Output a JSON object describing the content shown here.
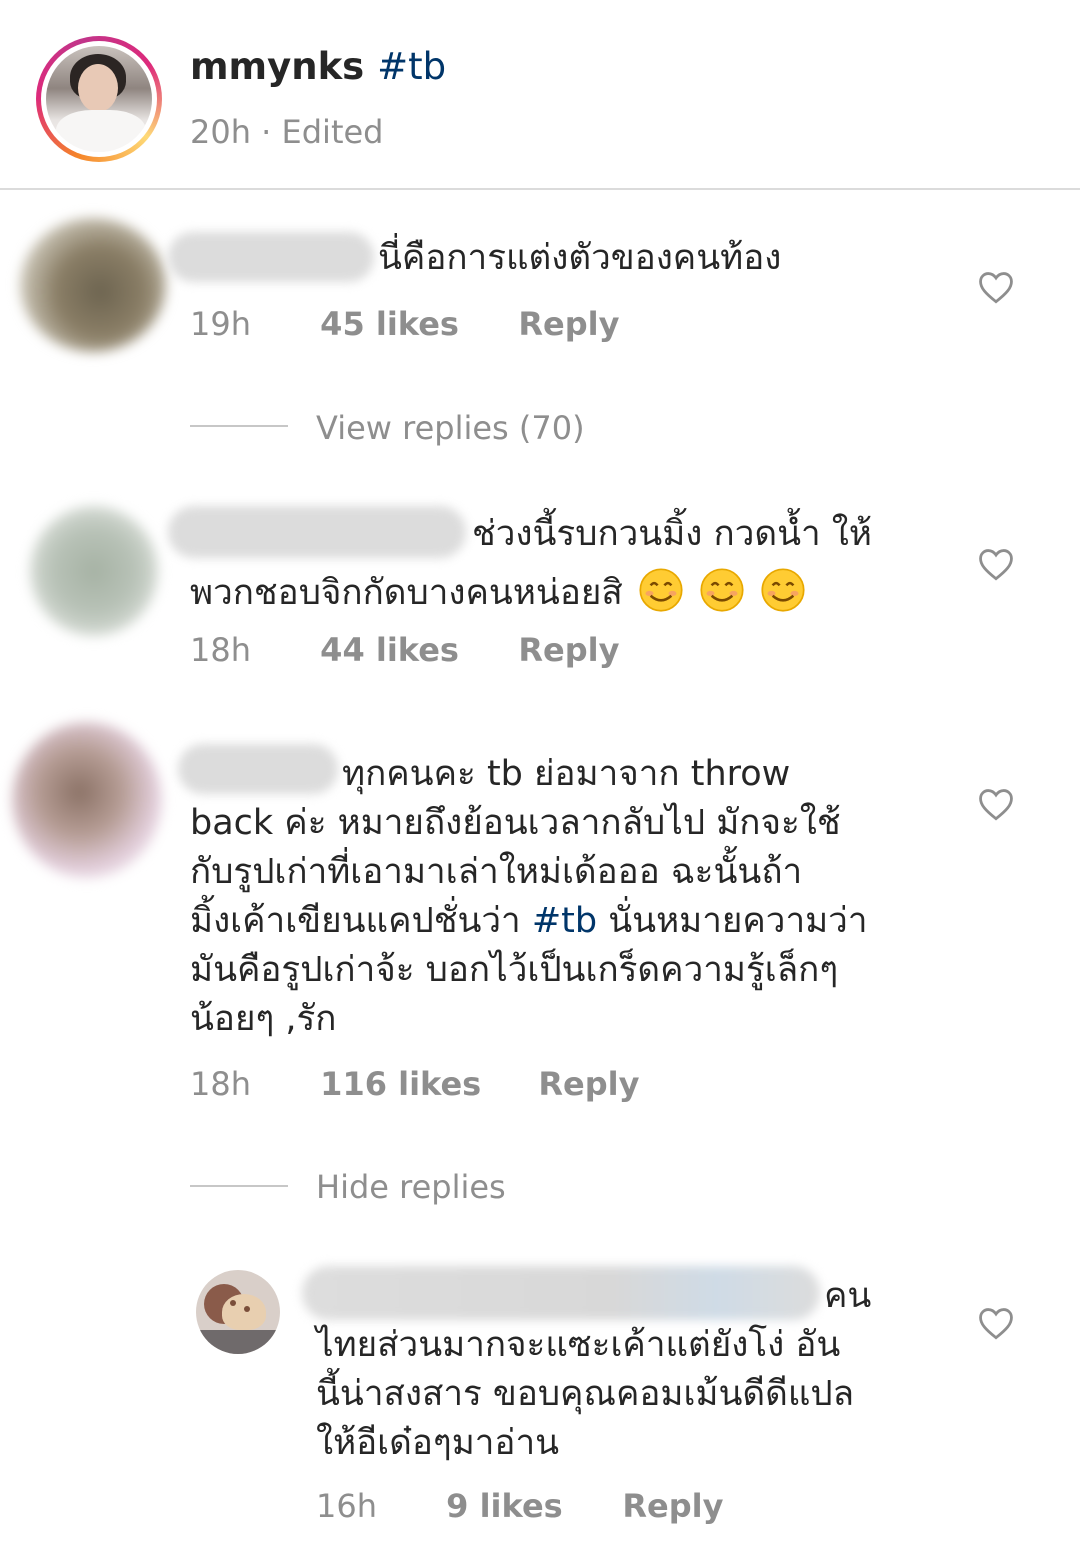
{
  "post": {
    "username": "mmynks",
    "hashtag": "#tb",
    "time": "20h",
    "separator": "·",
    "edited": "Edited"
  },
  "comments": [
    {
      "text": "นี่คือการแต่งตัวของคนท้อง",
      "time": "19h",
      "likes": "45 likes",
      "reply": "Reply"
    },
    {
      "text_line1": "ช่วงนี้รบกวนมิ้ง กวดน้ำ ให้",
      "text_line2": "พวกชอบจิกกัดบางคนหน่อยสิ",
      "emoji": "smiling-face-with-smiling-eyes",
      "time": "18h",
      "likes": "44 likes",
      "reply": "Reply"
    },
    {
      "line1": "ทุกคนคะ tb ย่อมาจาก throw",
      "line2": "back ค่ะ หมายถึงย้อนเวลากลับไป มักจะใช้",
      "line3": "กับรูปเก่าที่เอามาเล่าใหม่เด้อออ ฉะนั้นถ้า",
      "line4_before": "มิ้งเค้าเขียนแคปชั่นว่า ",
      "line4_tag": "#tb",
      "line4_after": " นั่นหมายความว่า",
      "line5": "มันคือรูปเก่าจ้ะ บอกไว้เป็นเกร็ดความรู้เล็กๆ",
      "line6": "น้อยๆ ,รัก",
      "time": "18h",
      "likes": "116 likes",
      "reply": "Reply"
    }
  ],
  "view_replies": "View replies (70)",
  "hide_replies": "Hide replies",
  "reply_comment": {
    "line1": "คน",
    "line2": "ไทยส่วนมากจะแซะเค้าแต่ยังโง่ อัน",
    "line3": "นี้น่าสงสาร ขอบคุณคอมเม้นดีดีแปล",
    "line4": "ให้อีเด๋อๆมาอ่าน",
    "time": "16h",
    "likes": "9 likes",
    "reply": "Reply"
  },
  "colors": {
    "text": "#262626",
    "meta": "#8e8e8e",
    "hashtag": "#003569",
    "divider": "#dbdbdb"
  }
}
